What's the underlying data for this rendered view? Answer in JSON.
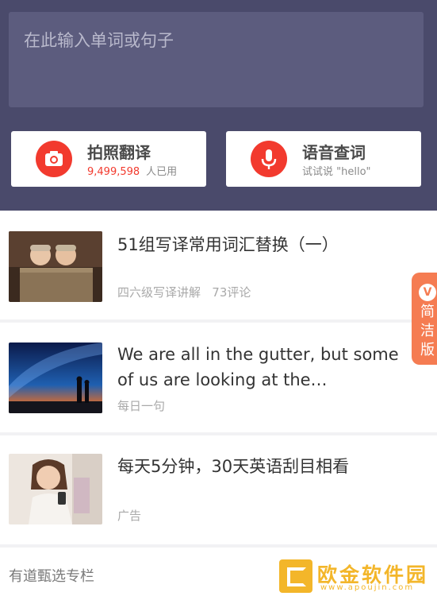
{
  "search": {
    "placeholder": "在此输入单词或句子"
  },
  "actions": {
    "photo": {
      "title": "拍照翻译",
      "count": "9,499,598",
      "suffix": "人已用",
      "icon": "camera-icon"
    },
    "voice": {
      "title": "语音查词",
      "sub": "试试说 \"hello\"",
      "icon": "microphone-icon"
    }
  },
  "feed": [
    {
      "title": "51组写译常用词汇替换（一）",
      "meta": "四六级写译讲解   73评论",
      "thumb": "babies-in-crate-photo"
    },
    {
      "title": "We are all in the gutter, but some of us are looking at the…",
      "meta": "每日一句",
      "thumb": "milky-way-couple-photo"
    },
    {
      "title": "每天5分钟，30天英语刮目相看",
      "meta": "广告",
      "thumb": "smiling-woman-with-phone-photo"
    }
  ],
  "section": {
    "label": "有道甄选专栏"
  },
  "float_tab": {
    "badge": "V",
    "label": "简洁版"
  },
  "watermark": {
    "name": "欧金软件园",
    "url": "www.apoujin.com"
  },
  "colors": {
    "header": "#4a4a6b",
    "accent_red": "#f23a2e",
    "tab_orange": "#f57c52",
    "watermark": "#f3b62a"
  }
}
